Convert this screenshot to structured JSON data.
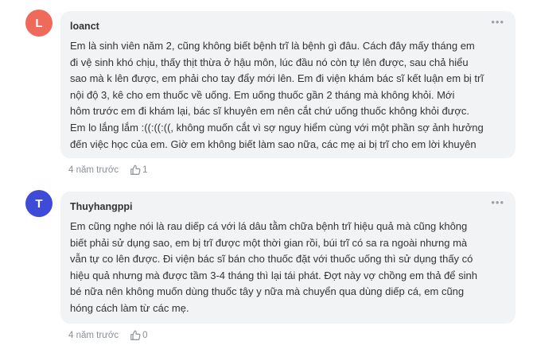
{
  "comments": [
    {
      "avatar_letter": "L",
      "avatar_color": "#ef6a5b",
      "author": "loanct",
      "more_icon": "more-horizontal-icon",
      "lines": [
        "Em là sinh viên năm 2, cũng không biết bệnh trĩ là bệnh gì đâu. Cách đây mấy tháng em",
        "đi vệ sinh khó chịu, thấy thịt thừa ở hậu môn, lúc đầu nó còn tự lên được, sau chả hiểu",
        "sao mà k lên được, em phải cho tay đẩy mới lên. Em đi viện khám bác sĩ kết luận em bị trĩ",
        "nội độ 3, kê cho em thuốc về uống. Em uống thuốc gần 2 tháng mà không khỏi. Mới",
        "hôm trước em đi khám lại, bác sĩ khuyên em nên cắt chứ uống thuốc không khỏi được.",
        "Em lo lắng lắm :((:((:((, không muốn cắt vì sợ nguy hiểm cùng với một phần sợ ảnh hưởng",
        "đến việc học của em. Giờ em không biết làm sao nữa, các mẹ ai bị trĩ cho em lời khuyên"
      ],
      "time": "4 năm trước",
      "likes": "1"
    },
    {
      "avatar_letter": "T",
      "avatar_color": "#3d4bd6",
      "author": "Thuyhangppi",
      "more_icon": "more-horizontal-icon",
      "lines": [
        "Em cũng nghe nói là rau diếp cá với lá dâu tằm chữa bệnh trĩ hiệu quả mà cũng không",
        "biết phải sử dụng sao, em bị trĩ được một thời gian rồi, búi trĩ có sa ra ngoài nhưng mà",
        "vẫn tự co lên được. Đi viện bác sĩ bán cho thuốc đặt với thuốc uống thì sử dụng thấy có",
        "hiệu quả nhưng mà được tầm 3-4 tháng thì lại tái phát. Đợt này vợ chồng em thả để sinh",
        "bé nữa nên không muốn dùng thuốc tây y nữa mà chuyển qua dùng diếp cá, em cũng",
        "hóng cách làm từ các mẹ."
      ],
      "time": "4 năm trước",
      "likes": "0"
    }
  ]
}
